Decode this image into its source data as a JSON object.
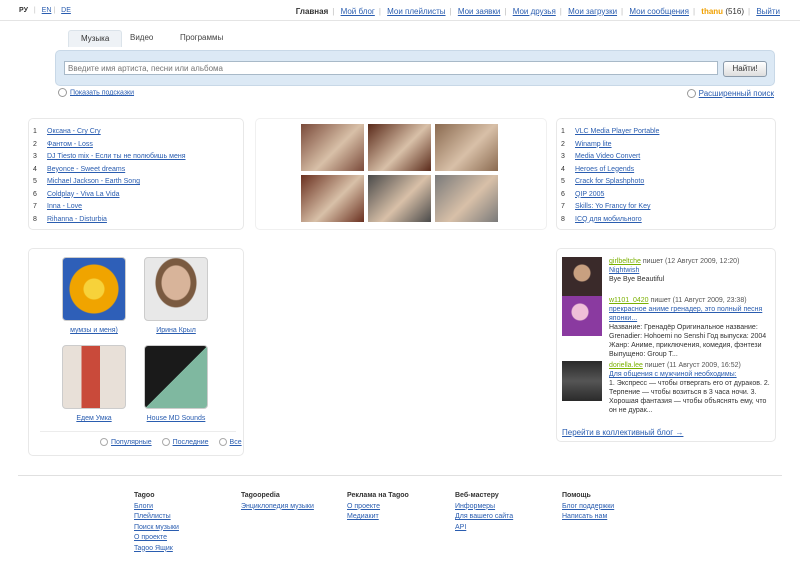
{
  "langs": [
    "РУ",
    "EN",
    "DE"
  ],
  "nav": {
    "items": [
      "Главная",
      "Мой блог",
      "Мои плейлисты",
      "Мои заявки",
      "Мои друзья",
      "Мои загрузки",
      "Мои сообщения"
    ],
    "user": "thanu",
    "count": "(516)",
    "logout": "Выйти"
  },
  "tabs": [
    "Музыка",
    "Видео",
    "Программы"
  ],
  "search": {
    "placeholder": "Введите имя артиста, песни или альбома",
    "button": "Найти!",
    "show_hints": "Показать подсказки",
    "advanced": "Расширенный поиск"
  },
  "top_songs": [
    "Оксана - Cry Cry",
    "Фантом - Loss",
    "DJ Tiesto mix - Если ты не полюбишь меня",
    "Beyonce - Sweet dreams",
    "Michael Jackson - Earth Song",
    "Coldplay - Viva La Vida",
    "Inna - Love",
    "Rihanna - Disturbia"
  ],
  "thumb_colors": [
    "#7a4a3a",
    "#5a2a1a",
    "#8a6a50",
    "#6a3020",
    "#4a4a4a",
    "#7a7a7a"
  ],
  "top_programs": [
    "VLC Media Player Portable",
    "Winamp lite",
    "Media Video Convert",
    "Heroes of Legends",
    "Crack for Splashphoto",
    "QIP 2005",
    "Skills: Yo Francy for Key",
    "ICQ для мобильного"
  ],
  "friends": [
    {
      "name": "мумзы и меня)",
      "color": "#2e5fb8"
    },
    {
      "name": "Ирина Крыл",
      "color": "#d8c4b0"
    },
    {
      "name": "Едeм Умкa",
      "color": "#c94a3a"
    },
    {
      "name": "House MD Sounds",
      "color": "#3a4a3a"
    }
  ],
  "filters": [
    "Популярные",
    "Последние",
    "Все"
  ],
  "blog": [
    {
      "user": "girlbeltche",
      "action": "пишет",
      "date": "(12 Август 2009, 12:20)",
      "title": "Nightwish",
      "text": "Bye Bye Beautiful",
      "color": "#3a2a2a"
    },
    {
      "user": "w1101_0420",
      "action": "пишет",
      "date": "(11 Август 2009, 23:38)",
      "title": "прекрасное аниме гренадер, это полный песня японки...",
      "text": "Название: Гренадёр Оригинальное название: Grenadier: Hohoemi no Senshi Год выпуска: 2004 Жанр: Аниме, приключения, комедия, фэнтези Выпущено: Group T...",
      "color": "#8a3aa0"
    },
    {
      "user": "doriella.lee",
      "action": "пишет",
      "date": "(11 Август 2009, 16:52)",
      "title": "Для общения с мужчиной необходимы:",
      "text": "1. Экспресс — чтобы отвергать его от дураков. 2. Терпение — чтобы возиться в 3 часа ночи. 3. Хорошая фантазия — чтобы объяснять ему, что он не дурак...",
      "color": "#2a2a2a"
    }
  ],
  "blog_more": "Перейти в коллективный блог →",
  "footer": [
    {
      "head": "Tagoo",
      "links": [
        "Блоги",
        "Плейлисты",
        "Поиск музыки",
        "О проекте",
        "Tagoo Ящик"
      ]
    },
    {
      "head": "Tagoopedia",
      "links": [
        "Энциклопедия музыки"
      ]
    },
    {
      "head": "Реклама на Tagoo",
      "links": [
        "О проекте",
        "Медиакит"
      ]
    },
    {
      "head": "Веб-мастеру",
      "links": [
        "Информеры",
        "Для вашего сайта",
        "API"
      ]
    },
    {
      "head": "Помощь",
      "links": [
        "Блог поддержки",
        "Написать нам"
      ]
    }
  ]
}
